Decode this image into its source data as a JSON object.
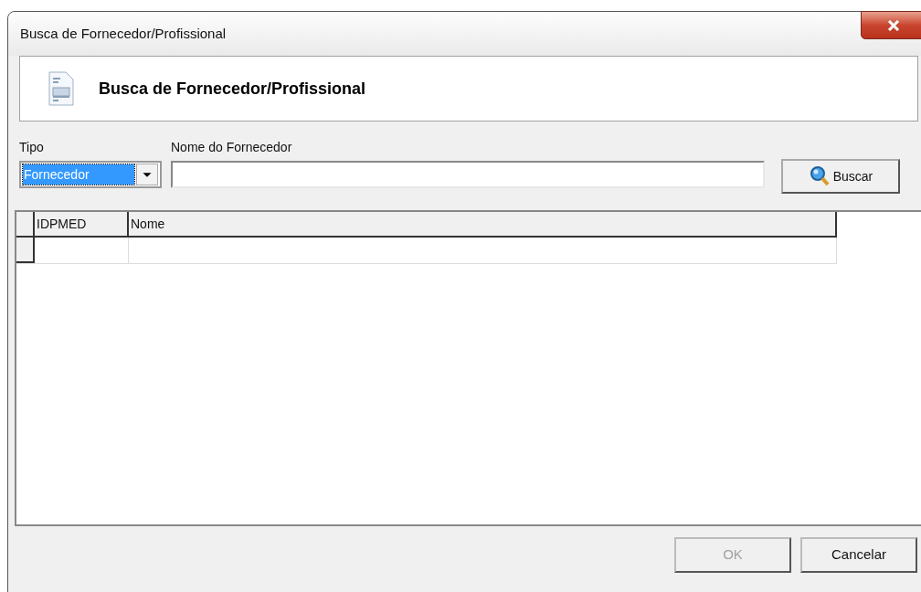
{
  "window": {
    "title": "Busca de Fornecedor/Profissional"
  },
  "header": {
    "title": "Busca de Fornecedor/Profissional"
  },
  "form": {
    "tipo_label": "Tipo",
    "tipo_value": "Fornecedor",
    "tipo_focused": true,
    "nome_label": "Nome do Fornecedor",
    "search_button": "Buscar"
  },
  "table": {
    "columns": [
      "IDPMED",
      "Nome"
    ]
  },
  "buttons": [
    {
      "label": "OK",
      "disabled": true
    },
    {
      "label": "Cancelar",
      "disabled": false
    }
  ]
}
